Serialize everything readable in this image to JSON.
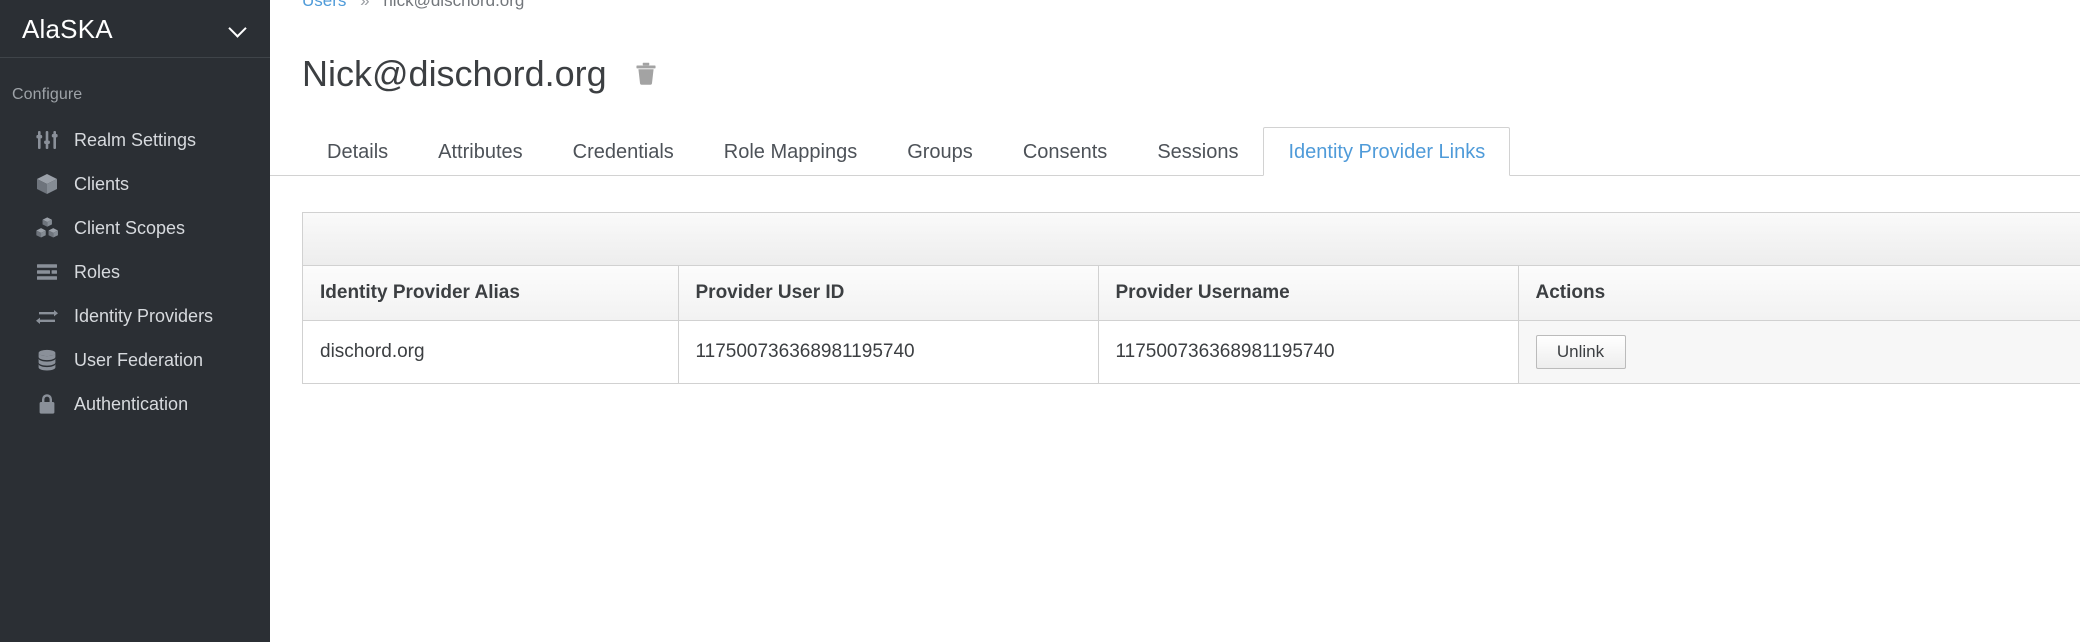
{
  "sidebar": {
    "realm_name": "AlaSKA",
    "realm_chevron_icon": "chevron-down-icon",
    "section_label": "Configure",
    "items": [
      {
        "label": "Realm Settings",
        "icon": "sliders-icon"
      },
      {
        "label": "Clients",
        "icon": "cube-icon"
      },
      {
        "label": "Client Scopes",
        "icon": "cubes-icon"
      },
      {
        "label": "Roles",
        "icon": "list-bars-icon"
      },
      {
        "label": "Identity Providers",
        "icon": "exchange-arrows-icon"
      },
      {
        "label": "User Federation",
        "icon": "database-icon"
      },
      {
        "label": "Authentication",
        "icon": "lock-icon"
      }
    ]
  },
  "breadcrumb": {
    "parent_label": "Users",
    "separator": "»",
    "current_label": "nick@dischord.org"
  },
  "header": {
    "title": "Nick@dischord.org",
    "delete_icon": "trash-icon"
  },
  "tabs": [
    {
      "label": "Details",
      "active": false
    },
    {
      "label": "Attributes",
      "active": false
    },
    {
      "label": "Credentials",
      "active": false
    },
    {
      "label": "Role Mappings",
      "active": false
    },
    {
      "label": "Groups",
      "active": false
    },
    {
      "label": "Consents",
      "active": false
    },
    {
      "label": "Sessions",
      "active": false
    },
    {
      "label": "Identity Provider Links",
      "active": true
    }
  ],
  "table": {
    "columns": [
      "Identity Provider Alias",
      "Provider User ID",
      "Provider Username",
      "Actions"
    ],
    "rows": [
      {
        "alias": "dischord.org",
        "provider_user_id": "117500736368981195740",
        "provider_username": "117500736368981195740",
        "action_label": "Unlink"
      }
    ]
  },
  "colors": {
    "sidebar_bg": "#2b2f34",
    "accent_blue": "#4f9bd9",
    "text_dark": "#3c3f42",
    "border_gray": "#d1d1d1"
  }
}
